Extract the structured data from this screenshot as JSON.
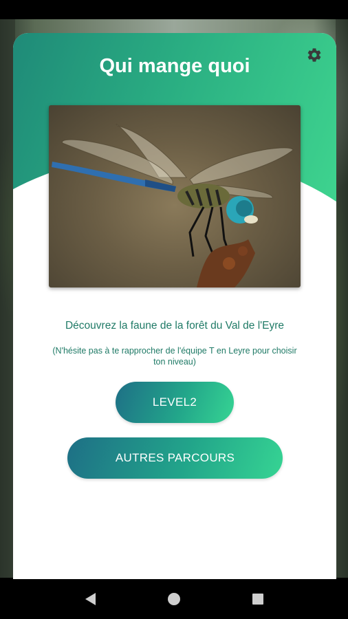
{
  "app": {
    "title": "Qui mange quoi"
  },
  "icons": {
    "settings": "gear-icon",
    "nav_back": "triangle-back-icon",
    "nav_home": "circle-home-icon",
    "nav_recents": "square-recents-icon"
  },
  "main": {
    "tagline": "Découvrez la faune de la forêt du Val de l'Eyre",
    "hint": "(N'hésite pas à te rapprocher de l'équipe T en Leyre pour choisir ton niveau)",
    "level_button": "LEVEL2",
    "other_button": "AUTRES PARCOURS"
  },
  "colors": {
    "header_gradient_start": "#1f8a78",
    "header_gradient_end": "#3fd58f",
    "text_teal": "#1f7a66",
    "button_gradient_start": "#1e6f86",
    "button_gradient_end": "#36d493"
  }
}
